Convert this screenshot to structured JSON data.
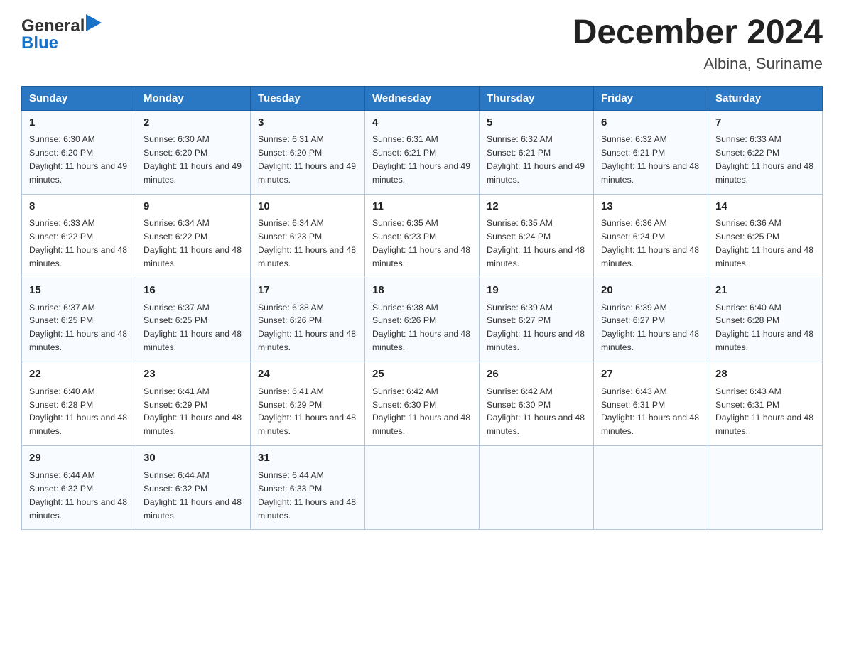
{
  "header": {
    "logo_general": "General",
    "logo_blue": "Blue",
    "title": "December 2024",
    "subtitle": "Albina, Suriname"
  },
  "calendar": {
    "days_of_week": [
      "Sunday",
      "Monday",
      "Tuesday",
      "Wednesday",
      "Thursday",
      "Friday",
      "Saturday"
    ],
    "weeks": [
      [
        {
          "day": "1",
          "sunrise": "6:30 AM",
          "sunset": "6:20 PM",
          "daylight": "11 hours and 49 minutes."
        },
        {
          "day": "2",
          "sunrise": "6:30 AM",
          "sunset": "6:20 PM",
          "daylight": "11 hours and 49 minutes."
        },
        {
          "day": "3",
          "sunrise": "6:31 AM",
          "sunset": "6:20 PM",
          "daylight": "11 hours and 49 minutes."
        },
        {
          "day": "4",
          "sunrise": "6:31 AM",
          "sunset": "6:21 PM",
          "daylight": "11 hours and 49 minutes."
        },
        {
          "day": "5",
          "sunrise": "6:32 AM",
          "sunset": "6:21 PM",
          "daylight": "11 hours and 49 minutes."
        },
        {
          "day": "6",
          "sunrise": "6:32 AM",
          "sunset": "6:21 PM",
          "daylight": "11 hours and 48 minutes."
        },
        {
          "day": "7",
          "sunrise": "6:33 AM",
          "sunset": "6:22 PM",
          "daylight": "11 hours and 48 minutes."
        }
      ],
      [
        {
          "day": "8",
          "sunrise": "6:33 AM",
          "sunset": "6:22 PM",
          "daylight": "11 hours and 48 minutes."
        },
        {
          "day": "9",
          "sunrise": "6:34 AM",
          "sunset": "6:22 PM",
          "daylight": "11 hours and 48 minutes."
        },
        {
          "day": "10",
          "sunrise": "6:34 AM",
          "sunset": "6:23 PM",
          "daylight": "11 hours and 48 minutes."
        },
        {
          "day": "11",
          "sunrise": "6:35 AM",
          "sunset": "6:23 PM",
          "daylight": "11 hours and 48 minutes."
        },
        {
          "day": "12",
          "sunrise": "6:35 AM",
          "sunset": "6:24 PM",
          "daylight": "11 hours and 48 minutes."
        },
        {
          "day": "13",
          "sunrise": "6:36 AM",
          "sunset": "6:24 PM",
          "daylight": "11 hours and 48 minutes."
        },
        {
          "day": "14",
          "sunrise": "6:36 AM",
          "sunset": "6:25 PM",
          "daylight": "11 hours and 48 minutes."
        }
      ],
      [
        {
          "day": "15",
          "sunrise": "6:37 AM",
          "sunset": "6:25 PM",
          "daylight": "11 hours and 48 minutes."
        },
        {
          "day": "16",
          "sunrise": "6:37 AM",
          "sunset": "6:25 PM",
          "daylight": "11 hours and 48 minutes."
        },
        {
          "day": "17",
          "sunrise": "6:38 AM",
          "sunset": "6:26 PM",
          "daylight": "11 hours and 48 minutes."
        },
        {
          "day": "18",
          "sunrise": "6:38 AM",
          "sunset": "6:26 PM",
          "daylight": "11 hours and 48 minutes."
        },
        {
          "day": "19",
          "sunrise": "6:39 AM",
          "sunset": "6:27 PM",
          "daylight": "11 hours and 48 minutes."
        },
        {
          "day": "20",
          "sunrise": "6:39 AM",
          "sunset": "6:27 PM",
          "daylight": "11 hours and 48 minutes."
        },
        {
          "day": "21",
          "sunrise": "6:40 AM",
          "sunset": "6:28 PM",
          "daylight": "11 hours and 48 minutes."
        }
      ],
      [
        {
          "day": "22",
          "sunrise": "6:40 AM",
          "sunset": "6:28 PM",
          "daylight": "11 hours and 48 minutes."
        },
        {
          "day": "23",
          "sunrise": "6:41 AM",
          "sunset": "6:29 PM",
          "daylight": "11 hours and 48 minutes."
        },
        {
          "day": "24",
          "sunrise": "6:41 AM",
          "sunset": "6:29 PM",
          "daylight": "11 hours and 48 minutes."
        },
        {
          "day": "25",
          "sunrise": "6:42 AM",
          "sunset": "6:30 PM",
          "daylight": "11 hours and 48 minutes."
        },
        {
          "day": "26",
          "sunrise": "6:42 AM",
          "sunset": "6:30 PM",
          "daylight": "11 hours and 48 minutes."
        },
        {
          "day": "27",
          "sunrise": "6:43 AM",
          "sunset": "6:31 PM",
          "daylight": "11 hours and 48 minutes."
        },
        {
          "day": "28",
          "sunrise": "6:43 AM",
          "sunset": "6:31 PM",
          "daylight": "11 hours and 48 minutes."
        }
      ],
      [
        {
          "day": "29",
          "sunrise": "6:44 AM",
          "sunset": "6:32 PM",
          "daylight": "11 hours and 48 minutes."
        },
        {
          "day": "30",
          "sunrise": "6:44 AM",
          "sunset": "6:32 PM",
          "daylight": "11 hours and 48 minutes."
        },
        {
          "day": "31",
          "sunrise": "6:44 AM",
          "sunset": "6:33 PM",
          "daylight": "11 hours and 48 minutes."
        },
        null,
        null,
        null,
        null
      ]
    ],
    "sunrise_label": "Sunrise:",
    "sunset_label": "Sunset:",
    "daylight_label": "Daylight:"
  }
}
